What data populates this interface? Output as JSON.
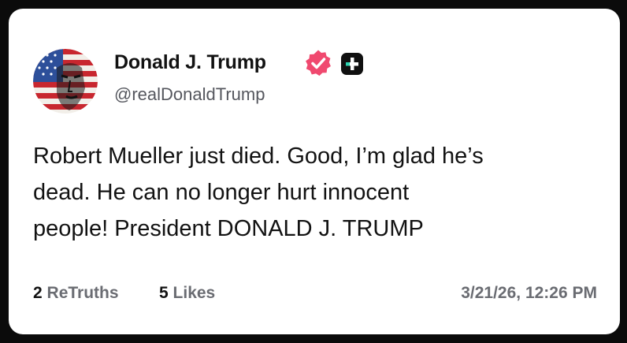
{
  "post": {
    "author": {
      "display_name": "Donald J. Trump",
      "handle": "@realDonaldTrump",
      "avatar_icon": "flag-portrait-avatar",
      "verified_icon": "verified-badge-icon",
      "verified_color": "#f0496f",
      "plus_icon": "plus-badge-icon",
      "plus_color": "#101010"
    },
    "text_lines": [
      "Robert Mueller just died. Good, I’m glad he’s",
      "dead. He can no longer hurt innocent",
      "people! President DONALD J. TRUMP"
    ],
    "stats": {
      "retruths_count": "2",
      "retruths_label": "ReTruths",
      "likes_count": "5",
      "likes_label": "Likes"
    },
    "timestamp": "3/21/26, 12:26 PM"
  }
}
